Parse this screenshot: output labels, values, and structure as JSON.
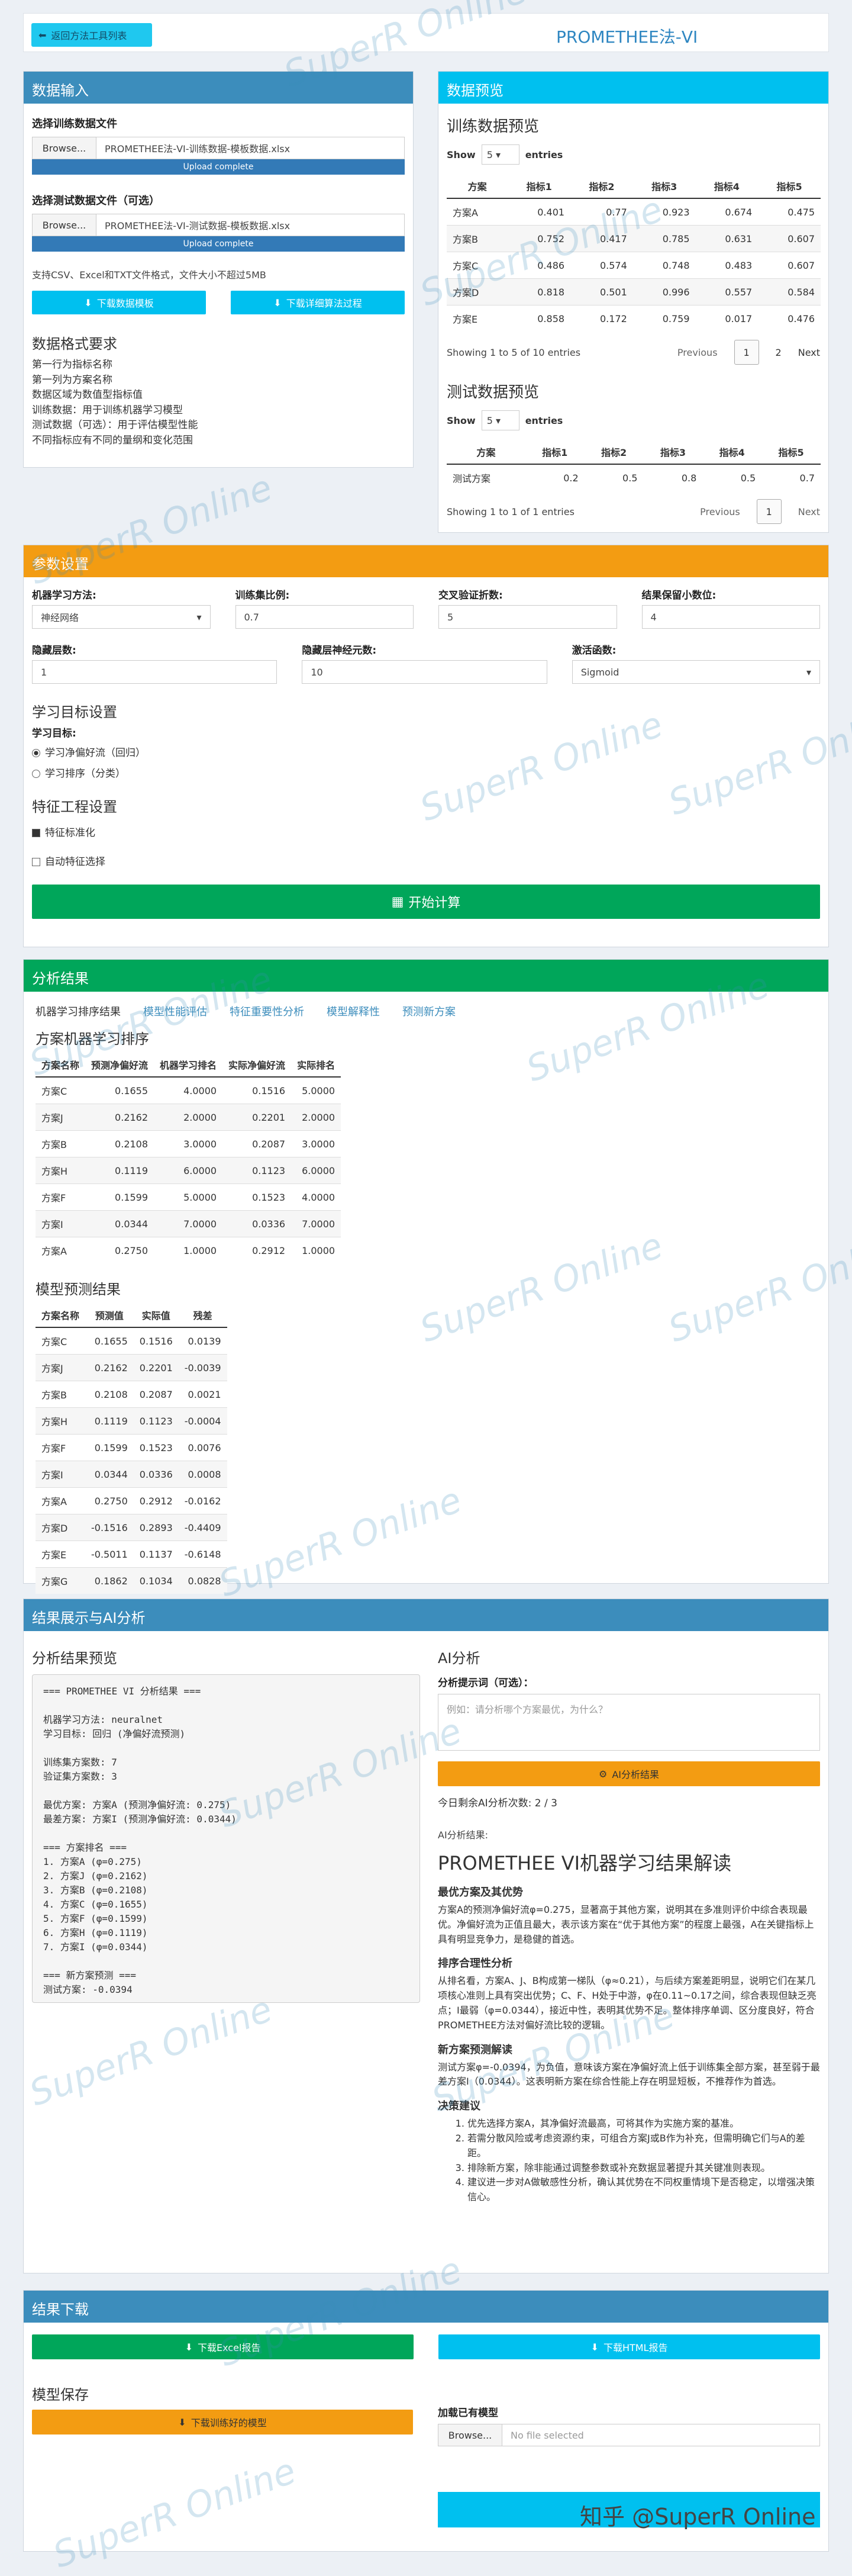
{
  "header": {
    "back_label": "返回方法工具列表",
    "title": "PROMETHEE法-VI"
  },
  "data_input": {
    "title": "数据输入",
    "train_label": "选择训练数据文件",
    "browse": "Browse...",
    "train_file": "PROMETHEE法-VI-训练数据-模板数据.xlsx",
    "upload_complete": "Upload complete",
    "test_label": "选择测试数据文件（可选）",
    "test_file": "PROMETHEE法-VI-测试数据-模板数据.xlsx",
    "support_text": "支持CSV、Excel和TXT文件格式，文件大小不超过5MB",
    "download_template": "下载数据模板",
    "download_process": "下载详细算法过程",
    "req_title": "数据格式要求",
    "req_lines": [
      "第一行为指标名称",
      "第一列为方案名称",
      "数据区域为数值型指标值",
      "训练数据：用于训练机器学习模型",
      "测试数据（可选）：用于评估模型性能",
      "不同指标应有不同的量纲和变化范围"
    ]
  },
  "preview": {
    "title": "数据预览",
    "train_title": "训练数据预览",
    "show": "Show",
    "entries": "entries",
    "page_size": "5",
    "headers": [
      "方案",
      "指标1",
      "指标2",
      "指标3",
      "指标4",
      "指标5"
    ],
    "rows": [
      [
        "方案A",
        "0.401",
        "0.77",
        "0.923",
        "0.674",
        "0.475"
      ],
      [
        "方案B",
        "0.752",
        "0.417",
        "0.785",
        "0.631",
        "0.607"
      ],
      [
        "方案C",
        "0.486",
        "0.574",
        "0.748",
        "0.483",
        "0.607"
      ],
      [
        "方案D",
        "0.818",
        "0.501",
        "0.996",
        "0.557",
        "0.584"
      ],
      [
        "方案E",
        "0.858",
        "0.172",
        "0.759",
        "0.017",
        "0.476"
      ]
    ],
    "train_info": "Showing 1 to 5 of 10 entries",
    "previous": "Previous",
    "next": "Next",
    "pages": [
      "1",
      "2"
    ],
    "test_title": "测试数据预览",
    "test_rows": [
      [
        "测试方案",
        "0.2",
        "0.5",
        "0.8",
        "0.5",
        "0.7"
      ]
    ],
    "test_info": "Showing 1 to 1 of 1 entries"
  },
  "params": {
    "title": "参数设置",
    "ml_label": "机器学习方法:",
    "ml_value": "神经网络",
    "ratio_label": "训练集比例:",
    "ratio_value": "0.7",
    "cv_label": "交叉验证折数:",
    "cv_value": "5",
    "dec_label": "结果保留小数位:",
    "dec_value": "4",
    "hidden_label": "隐藏层数:",
    "hidden_value": "1",
    "neurons_label": "隐藏层神经元数:",
    "neurons_value": "10",
    "act_label": "激活函数:",
    "act_value": "Sigmoid",
    "goal_title": "学习目标设置",
    "goal_label": "学习目标:",
    "goal_opt1": "学习净偏好流（回归）",
    "goal_opt2": "学习排序（分类）",
    "feat_title": "特征工程设置",
    "feat_opt1": "特征标准化",
    "feat_opt2": "自动特征选择",
    "start": "开始计算"
  },
  "analysis": {
    "title": "分析结果",
    "tabs": [
      "机器学习排序结果",
      "模型性能评估",
      "特征重要性分析",
      "模型解释性",
      "预测新方案"
    ],
    "rank_title": "方案机器学习排序",
    "rank_headers": [
      "方案名称",
      "预测净偏好流",
      "机器学习排名",
      "实际净偏好流",
      "实际排名"
    ],
    "rank_rows": [
      [
        "方案C",
        "0.1655",
        "4.0000",
        "0.1516",
        "5.0000"
      ],
      [
        "方案J",
        "0.2162",
        "2.0000",
        "0.2201",
        "2.0000"
      ],
      [
        "方案B",
        "0.2108",
        "3.0000",
        "0.2087",
        "3.0000"
      ],
      [
        "方案H",
        "0.1119",
        "6.0000",
        "0.1123",
        "6.0000"
      ],
      [
        "方案F",
        "0.1599",
        "5.0000",
        "0.1523",
        "4.0000"
      ],
      [
        "方案I",
        "0.0344",
        "7.0000",
        "0.0336",
        "7.0000"
      ],
      [
        "方案A",
        "0.2750",
        "1.0000",
        "0.2912",
        "1.0000"
      ]
    ],
    "pred_title": "模型预测结果",
    "pred_headers": [
      "方案名称",
      "预测值",
      "实际值",
      "残差"
    ],
    "pred_rows": [
      [
        "方案C",
        "0.1655",
        "0.1516",
        "0.0139"
      ],
      [
        "方案J",
        "0.2162",
        "0.2201",
        "-0.0039"
      ],
      [
        "方案B",
        "0.2108",
        "0.2087",
        "0.0021"
      ],
      [
        "方案H",
        "0.1119",
        "0.1123",
        "-0.0004"
      ],
      [
        "方案F",
        "0.1599",
        "0.1523",
        "0.0076"
      ],
      [
        "方案I",
        "0.0344",
        "0.0336",
        "0.0008"
      ],
      [
        "方案A",
        "0.2750",
        "0.2912",
        "-0.0162"
      ],
      [
        "方案D",
        "-0.1516",
        "0.2893",
        "-0.4409"
      ],
      [
        "方案E",
        "-0.5011",
        "0.1137",
        "-0.6148"
      ],
      [
        "方案G",
        "0.1862",
        "0.1034",
        "0.0828"
      ]
    ]
  },
  "ai_section": {
    "title": "结果展示与AI分析",
    "preview_title": "分析结果预览",
    "code": "=== PROMETHEE VI 分析结果 ===\n\n机器学习方法: neuralnet\n学习目标: 回归 (净偏好流预测)\n\n训练集方案数: 7\n验证集方案数: 3\n\n最优方案: 方案A (预测净偏好流: 0.275)\n最差方案: 方案I (预测净偏好流: 0.0344)\n\n=== 方案排名 ===\n1. 方案A (φ=0.275)\n2. 方案J (φ=0.2162)\n3. 方案B (φ=0.2108)\n4. 方案C (φ=0.1655)\n5. 方案F (φ=0.1599)\n6. 方案H (φ=0.1119)\n7. 方案I (φ=0.0344)\n\n=== 新方案预测 ===\n测试方案: -0.0394",
    "ai_title": "AI分析",
    "prompt_label": "分析提示词（可选）：",
    "prompt_placeholder": "例如：请分析哪个方案最优，为什么？",
    "ai_button": "AI分析结果",
    "remaining": "今日剩余AI分析次数: 2 / 3",
    "ai_result_label": "AI分析结果:",
    "report_title": "PROMETHEE VI机器学习结果解读",
    "h1": "最优方案及其优势",
    "p1": "方案A的预测净偏好流φ=0.275，显著高于其他方案，说明其在多准则评价中综合表现最优。净偏好流为正值且最大，表示该方案在“优于其他方案”的程度上最强，A在关键指标上具有明显竞争力，是稳健的首选。",
    "h2": "排序合理性分析",
    "p2": "从排名看，方案A、J、B构成第一梯队（φ≈0.21），与后续方案差距明显，说明它们在某几项核心准则上具有突出优势；C、F、H处于中游，φ在0.11~0.17之间，综合表现但缺乏亮点；I最弱（φ=0.0344），接近中性，表明其优势不足。整体排序单调、区分度良好，符合PROMETHEE方法对偏好流比较的逻辑。",
    "h3": "新方案预测解读",
    "p3": "测试方案φ=-0.0394，为负值，意味该方案在净偏好流上低于训练集全部方案，甚至弱于最差方案I（0.0344）。这表明新方案在综合性能上存在明显短板，不推荐作为首选。",
    "h4": "决策建议",
    "advice": [
      "优先选择方案A，其净偏好流最高，可将其作为实施方案的基准。",
      "若需分散风险或考虑资源约束，可组合方案J或B作为补充，但需明确它们与A的差距。",
      "排除新方案，除非能通过调整参数或补充数据显著提升其关键准则表现。",
      "建议进一步对A做敏感性分析，确认其优势在不同权重情境下是否稳定，以增强决策信心。"
    ]
  },
  "download": {
    "title": "结果下载",
    "excel": "下载Excel报告",
    "html": "下载HTML报告",
    "model_title": "模型保存",
    "model_btn": "下载训练好的模型",
    "load_label": "加载已有模型",
    "browse": "Browse...",
    "no_file": "No file selected"
  },
  "watermark": "SuperR Online",
  "footer_mark": "知乎 @SuperR Online"
}
